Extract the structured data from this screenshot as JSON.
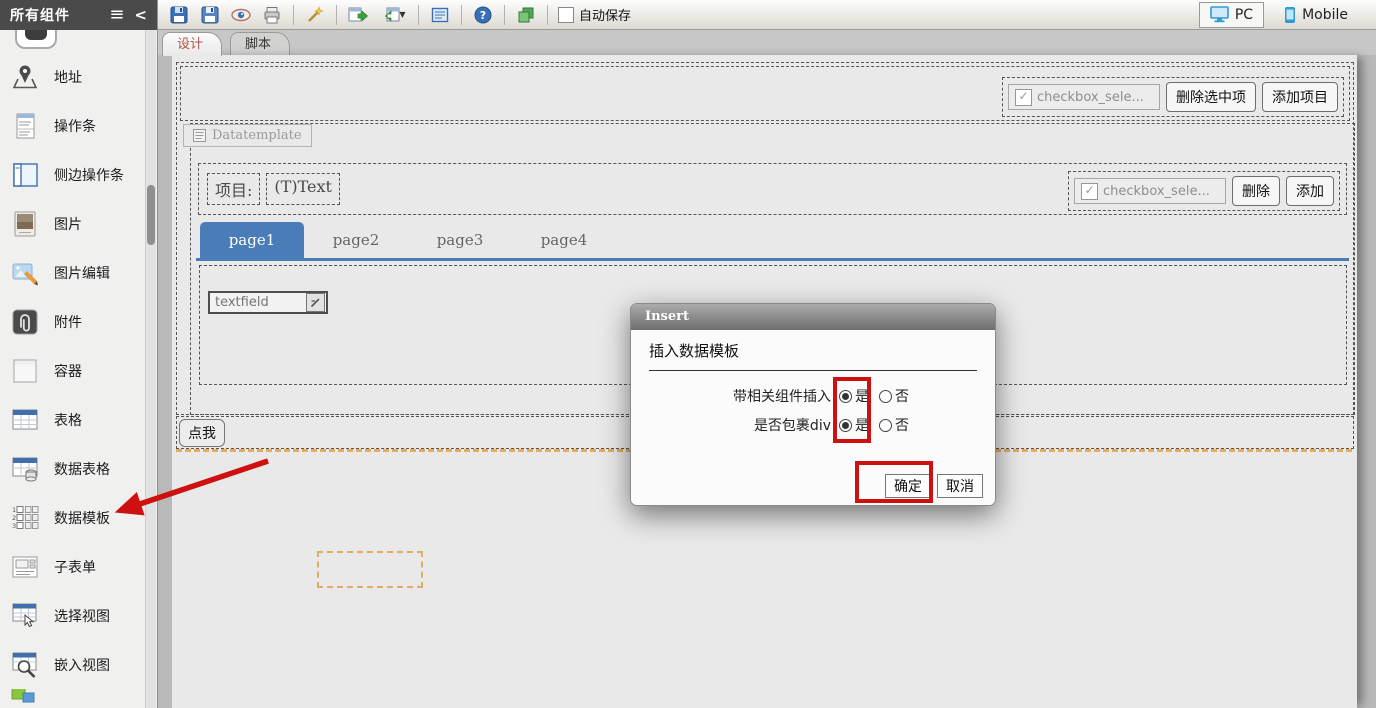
{
  "colors": {
    "accent_blue": "#4a7cb8",
    "annotation_red": "#cf1010",
    "orange_dash": "#e3ab63",
    "device_icon_blue": "#33a3dc"
  },
  "sidebar": {
    "title": "所有组件",
    "items": [
      {
        "icon": "clipped-button-icon"
      },
      {
        "icon": "address-icon",
        "label": "地址"
      },
      {
        "icon": "action-bar-icon",
        "label": "操作条"
      },
      {
        "icon": "side-action-bar-icon",
        "label": "侧边操作条"
      },
      {
        "icon": "image-icon",
        "label": "图片"
      },
      {
        "icon": "image-edit-icon",
        "label": "图片编辑"
      },
      {
        "icon": "attachment-icon",
        "label": "附件"
      },
      {
        "icon": "container-icon",
        "label": "容器"
      },
      {
        "icon": "table-icon",
        "label": "表格"
      },
      {
        "icon": "data-table-icon",
        "label": "数据表格"
      },
      {
        "icon": "data-template-icon",
        "label": "数据模板"
      },
      {
        "icon": "subform-icon",
        "label": "子表单"
      },
      {
        "icon": "select-view-icon",
        "label": "选择视图"
      },
      {
        "icon": "embed-view-icon",
        "label": "嵌入视图"
      },
      {
        "icon": "clipped-green-icon"
      }
    ]
  },
  "toolbar": {
    "autosave_label": "自动保存",
    "icons": [
      "save-icon",
      "save-as-icon",
      "preview-icon",
      "print-icon",
      "wand-icon",
      "export-icon",
      "import-icon",
      "form-list-icon",
      "help-icon",
      "layers-icon"
    ],
    "help_glyph": "?"
  },
  "device_toggle": {
    "pc_label": "PC",
    "mobile_label": "Mobile",
    "active": "PC"
  },
  "view_tabs": {
    "design": "设计",
    "script": "脚本",
    "active": "设计"
  },
  "canvas": {
    "top_group": {
      "checkbox_label": "checkbox_sele...",
      "delete_selected_label": "删除选中项",
      "add_item_label": "添加项目"
    },
    "datatemplate": {
      "tag_label": "Datatemplate",
      "item_row": {
        "field_label": "项目:",
        "field_value": "(T)Text",
        "checkbox_label": "checkbox_sele...",
        "delete_label": "删除",
        "add_label": "添加"
      },
      "page_tabs": [
        "page1",
        "page2",
        "page3",
        "page4"
      ],
      "active_page": "page1",
      "textfield_placeholder": "textfield"
    },
    "click_me_label": "点我"
  },
  "dialog": {
    "title": "Insert",
    "heading": "插入数据模板",
    "options": [
      {
        "label": "带相关组件插入",
        "yes_label": "是",
        "no_label": "否",
        "selected": "是"
      },
      {
        "label": "是否包裹div",
        "yes_label": "是",
        "no_label": "否",
        "selected": "是"
      }
    ],
    "ok_label": "确定",
    "cancel_label": "取消"
  }
}
